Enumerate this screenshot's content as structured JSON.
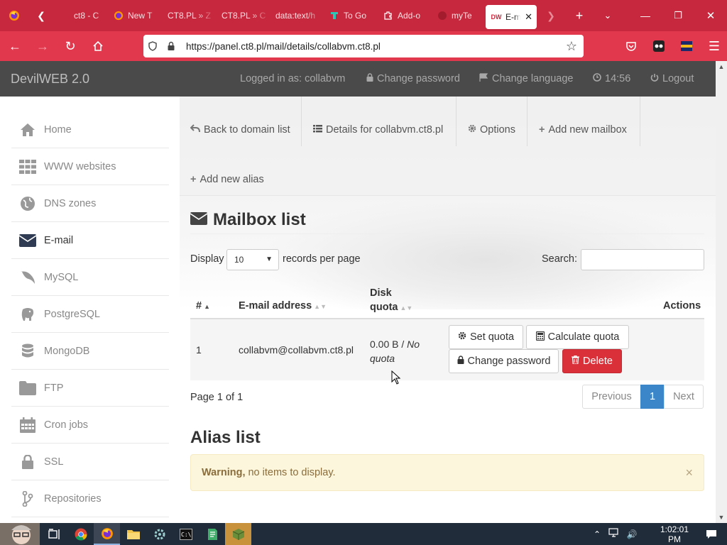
{
  "browser": {
    "tabs": [
      {
        "label": "ct8 - C",
        "icon": "firefox-icon"
      },
      {
        "label": "New T",
        "icon": "firefox-icon"
      },
      {
        "label": "CT8.PL » Z",
        "icon": "none"
      },
      {
        "label": "CT8.PL » C",
        "icon": "none"
      },
      {
        "label": "data:text/h",
        "icon": "none"
      },
      {
        "label": "To Go",
        "icon": "togo-icon"
      },
      {
        "label": "Add-o",
        "icon": "puzzle-icon"
      },
      {
        "label": "myTe",
        "icon": "mytemp-icon"
      },
      {
        "label": "E-m",
        "icon": "devilweb-icon",
        "active": true
      }
    ],
    "url": "https://panel.ct8.pl/mail/details/collabvm.ct8.pl"
  },
  "header": {
    "brand": "DevilWEB 2.0",
    "logged_in": "Logged in as: collabvm",
    "change_password": "Change password",
    "change_language": "Change language",
    "time": "14:56",
    "logout": "Logout"
  },
  "sidebar": {
    "items": [
      {
        "label": "Home"
      },
      {
        "label": "WWW websites"
      },
      {
        "label": "DNS zones"
      },
      {
        "label": "E-mail",
        "active": true
      },
      {
        "label": "MySQL"
      },
      {
        "label": "PostgreSQL"
      },
      {
        "label": "MongoDB"
      },
      {
        "label": "FTP"
      },
      {
        "label": "Cron jobs"
      },
      {
        "label": "SSL"
      },
      {
        "label": "Repositories"
      }
    ]
  },
  "subnav": {
    "back": "Back to domain list",
    "details": "Details for collabvm.ct8.pl",
    "options": "Options",
    "add_mailbox": "Add new mailbox",
    "add_alias": "Add new alias"
  },
  "mailbox": {
    "title": "Mailbox list",
    "display_label": "Display",
    "page_length": "10",
    "records_label": "records per page",
    "search_label": "Search:",
    "search_value": "",
    "columns": {
      "num": "#",
      "email": "E-mail address",
      "disk1": "Disk",
      "disk2": "quota",
      "actions": "Actions"
    },
    "rows": [
      {
        "num": "1",
        "email": "collabvm@collabvm.ct8.pl",
        "usage": "0.00 B /",
        "quota1": "No",
        "quota2": "quota"
      }
    ],
    "actions": {
      "set_quota": "Set quota",
      "calc_quota": "Calculate quota",
      "change_password": "Change password",
      "delete": "Delete"
    },
    "page_info": "Page 1 of 1",
    "pagination": {
      "prev": "Previous",
      "current": "1",
      "next": "Next"
    }
  },
  "alias": {
    "title": "Alias list",
    "warning_bold": "Warning,",
    "warning_text": "no items to display.",
    "close": "×"
  },
  "taskbar": {
    "clock": "1:02:01 PM"
  },
  "colors": {
    "firefox_tabbar": "#c8283d",
    "firefox_navbar": "#e2384d",
    "panel_header": "#4a4a4a",
    "primary": "#3a86c8",
    "danger": "#d9303a",
    "warning_bg": "#fcf6dd"
  }
}
